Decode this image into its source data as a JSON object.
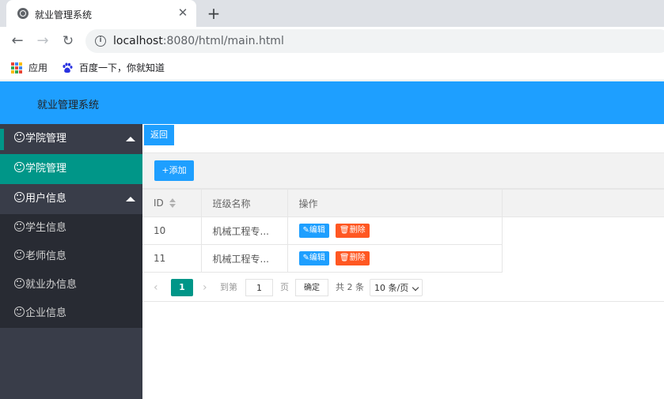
{
  "browser": {
    "tab_title": "就业管理系统",
    "url_host": "localhost",
    "url_rest": ":8080/html/main.html",
    "bookmarks": [
      {
        "label": "应用",
        "icon": "apps-grid-icon"
      },
      {
        "label": "百度一下，你就知道",
        "icon": "baidu-paw-icon"
      }
    ]
  },
  "app": {
    "title": "就业管理系统",
    "header_color": "#1e9fff"
  },
  "sidebar": {
    "groups": [
      {
        "label": "学院管理",
        "icon": "smile-icon",
        "expanded": true,
        "items": [
          {
            "label": "学院管理",
            "icon": "smile-icon",
            "active": true
          }
        ]
      },
      {
        "label": "用户信息",
        "icon": "smile-icon",
        "expanded": true,
        "items": [
          {
            "label": "学生信息",
            "icon": "smile-icon"
          },
          {
            "label": "老师信息",
            "icon": "smile-icon"
          },
          {
            "label": "就业办信息",
            "icon": "smile-icon"
          },
          {
            "label": "企业信息",
            "icon": "smile-icon"
          }
        ]
      }
    ]
  },
  "main": {
    "back_label": "返回",
    "add_label": "+添加",
    "table": {
      "columns": [
        "ID",
        "班级名称",
        "操作"
      ],
      "rows": [
        {
          "id": "10",
          "name": "机械工程专...",
          "edit": "编辑",
          "delete": "删除"
        },
        {
          "id": "11",
          "name": "机械工程专...",
          "edit": "编辑",
          "delete": "删除"
        }
      ]
    },
    "pager": {
      "prev": "‹",
      "current_page": "1",
      "next": "›",
      "goto_label": "到第",
      "input_value": "1",
      "page_label": "页",
      "confirm_label": "确定",
      "total_label": "共 2 条",
      "page_size": "10 条/页"
    }
  },
  "colors": {
    "accent_blue": "#1e9fff",
    "accent_green": "#009688",
    "danger": "#ff5722",
    "sidebar_bg": "#393d49"
  }
}
